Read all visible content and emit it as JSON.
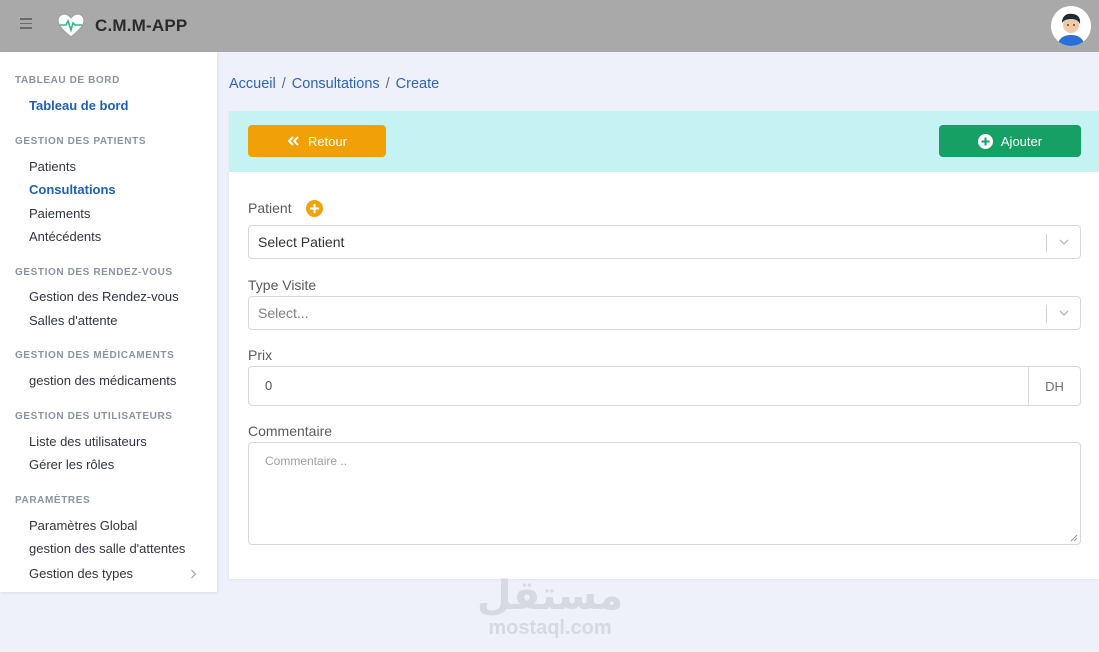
{
  "header": {
    "app_title": "C.M.M-APP"
  },
  "sidebar": {
    "sections": [
      {
        "title": "TABLEAU DE BORD",
        "items": [
          "Tableau de bord"
        ]
      },
      {
        "title": "GESTION DES PATIENTS",
        "items": [
          "Patients",
          "Consultations",
          "Paiements",
          "Antécédents"
        ]
      },
      {
        "title": "GESTION DES RENDEZ-VOUS",
        "items": [
          "Gestion des Rendez-vous",
          "Salles d'attente"
        ]
      },
      {
        "title": "GESTION DES MÉDICAMENTS",
        "items": [
          "gestion des médicaments"
        ]
      },
      {
        "title": "GESTION DES UTILISATEURS",
        "items": [
          "Liste des utilisateurs",
          "Gérer les rôles"
        ]
      },
      {
        "title": "PARAMÈTRES",
        "items": [
          "Paramètres Global",
          "gestion des salle d'attentes",
          "Gestion des types"
        ]
      }
    ]
  },
  "breadcrumb": {
    "home": "Accueil",
    "section": "Consultations",
    "current": "Create",
    "separator": "/"
  },
  "toolbar": {
    "back_label": "Retour",
    "add_label": "Ajouter"
  },
  "form": {
    "patient_label": "Patient",
    "patient_value": "Select Patient",
    "type_label": "Type Visite",
    "type_placeholder": "Select...",
    "prix_label": "Prix",
    "prix_value": "0",
    "prix_unit": "DH",
    "comment_label": "Commentaire",
    "comment_placeholder": "Commentaire .."
  },
  "watermark": {
    "arabic": "مستقل",
    "latin": "mostaql.com"
  },
  "colors": {
    "header": "#a9a9a9",
    "active_link": "#1f5fb3",
    "back_button": "#f2a007",
    "add_button": "#16a065",
    "card_header": "#c5f2f3"
  },
  "icons": {
    "menu": "hamburger-icon",
    "logo": "heart-pulse-icon",
    "back": "double-chevron-left-icon",
    "add": "plus-circle-icon",
    "chevron": "chevron-right-icon",
    "dropdown": "chevron-down-icon"
  }
}
